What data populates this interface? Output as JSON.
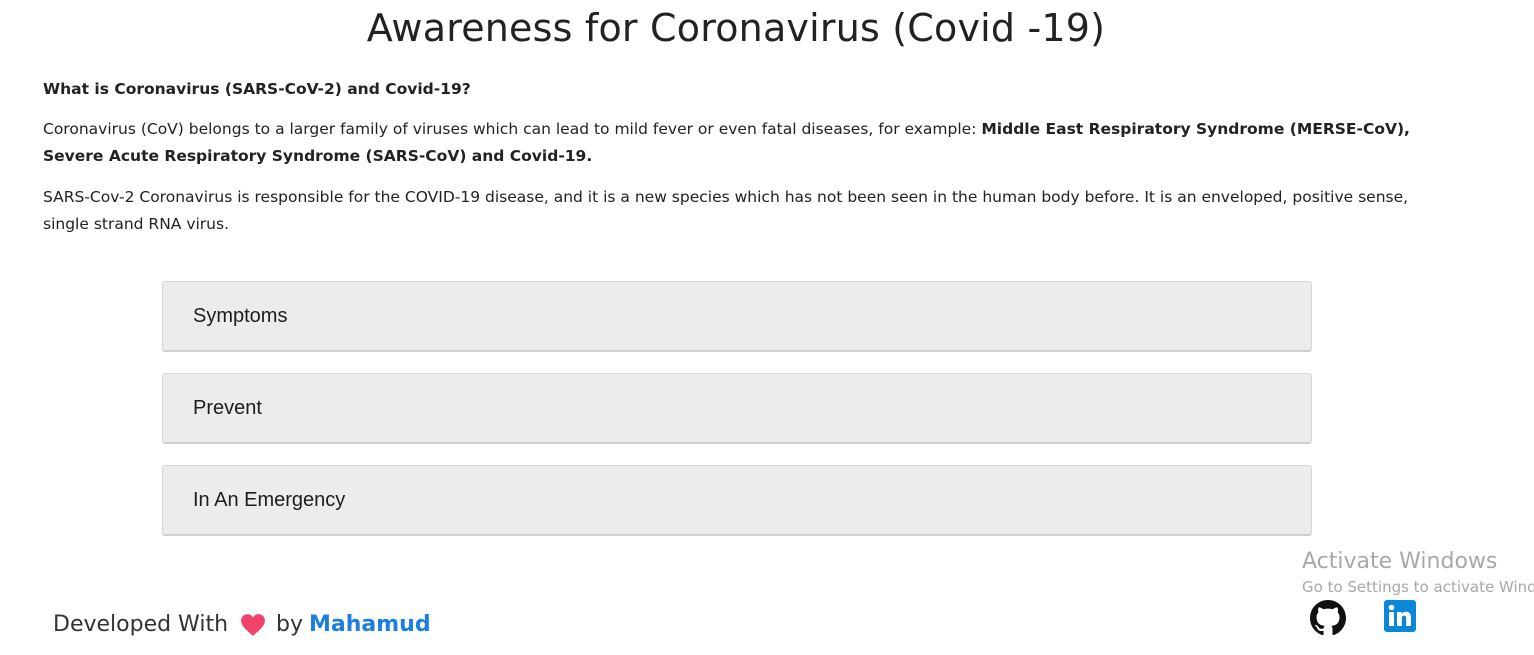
{
  "page": {
    "title": "Awareness for Coronavirus (Covid -19)"
  },
  "intro": {
    "question": "What is Coronavirus (SARS-CoV-2) and Covid-19?",
    "p1_text": "Coronavirus (CoV) belongs to a larger family of viruses which can lead to mild fever or even fatal diseases, for example: ",
    "p1_bold": "Middle East Respiratory Syndrome (MERSE-CoV), Severe Acute Respiratory Syndrome (SARS-CoV) and Covid-19.",
    "p2_text": "SARS-Cov-2 Coronavirus is responsible for the COVID-19 disease, and it is a new species which has not been seen in the human body before. It is an enveloped, positive sense, single strand RNA virus."
  },
  "accordion": {
    "items": [
      {
        "label": "Symptoms"
      },
      {
        "label": "Prevent"
      },
      {
        "label": "In An Emergency"
      }
    ]
  },
  "footer": {
    "developed_with": "Developed With",
    "by": "by",
    "author": "Mahamud",
    "heart_color": "#f0436a",
    "author_color": "#1a7fe0",
    "github_icon": "github-icon",
    "linkedin_icon": "linkedin-icon",
    "linkedin_color": "#0a88d8"
  },
  "watermark": {
    "line1": "Activate Windows",
    "line2": "Go to Settings to activate Windows."
  }
}
